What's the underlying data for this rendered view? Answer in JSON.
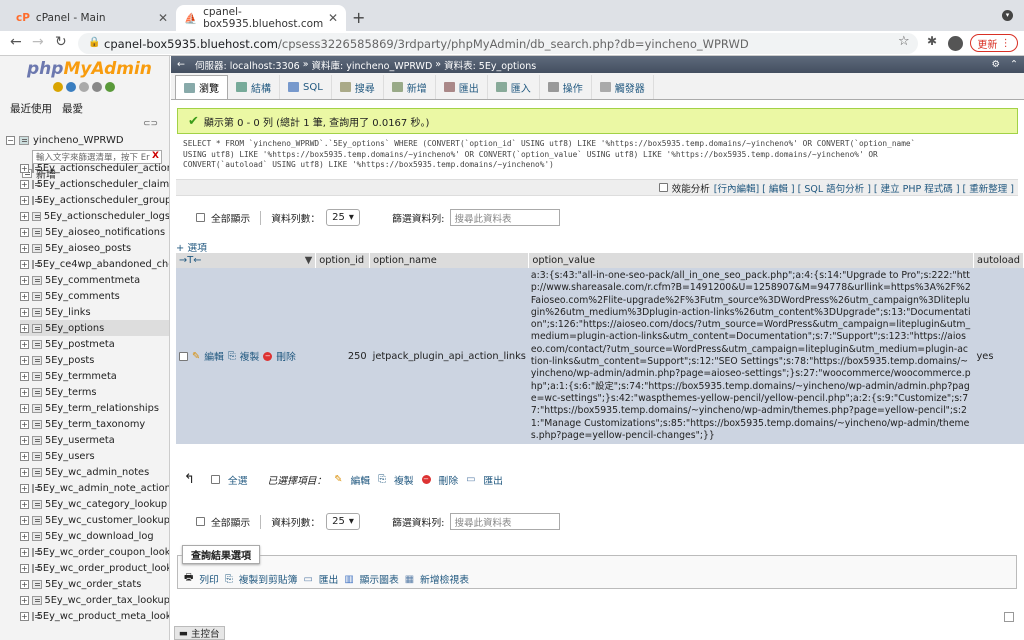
{
  "browser": {
    "tabs": [
      {
        "title": "cPanel - Main"
      },
      {
        "title": "cpanel-box5935.bluehost.com"
      }
    ],
    "url_host": "cpanel-box5935.bluehost.com",
    "url_path": "/cpsess3226585869/3rdparty/phpMyAdmin/db_search.php?db=yincheno_WPRWD",
    "update_label": "更新"
  },
  "sidebar": {
    "logo_php": "php",
    "logo_myadmin": "MyAdmin",
    "recent": "最近使用",
    "favorites": "最愛",
    "database": "yincheno_WPRWD",
    "filter_placeholder": "輸入文字來篩選清單，按下 Er",
    "filter_clear": "X",
    "new_label": "新增",
    "tables": [
      "5Ey_actionscheduler_actions",
      "5Ey_actionscheduler_claims",
      "5Ey_actionscheduler_groups",
      "5Ey_actionscheduler_logs",
      "5Ey_aioseo_notifications",
      "5Ey_aioseo_posts",
      "5Ey_ce4wp_abandoned_che",
      "5Ey_commentmeta",
      "5Ey_comments",
      "5Ey_links",
      "5Ey_options",
      "5Ey_postmeta",
      "5Ey_posts",
      "5Ey_termmeta",
      "5Ey_terms",
      "5Ey_term_relationships",
      "5Ey_term_taxonomy",
      "5Ey_usermeta",
      "5Ey_users",
      "5Ey_wc_admin_notes",
      "5Ey_wc_admin_note_actions",
      "5Ey_wc_category_lookup",
      "5Ey_wc_customer_lookup",
      "5Ey_wc_download_log",
      "5Ey_wc_order_coupon_looku",
      "5Ey_wc_order_product_looku",
      "5Ey_wc_order_stats",
      "5Ey_wc_order_tax_lookup",
      "5Ey_wc_product_meta_looku"
    ],
    "selected_table": "5Ey_options"
  },
  "breadcrumb": {
    "server": "伺服器: localhost:3306",
    "db": "資料庫: yincheno_WPRWD",
    "table": "資料表: 5Ey_options"
  },
  "menu": {
    "items": [
      "瀏覽",
      "結構",
      "SQL",
      "搜尋",
      "新增",
      "匯出",
      "匯入",
      "操作",
      "觸發器"
    ]
  },
  "success_message": "顯示第 0 - 0 列 (總計 1 筆, 查詢用了 0.0167 秒。)",
  "sql": {
    "line1": "SELECT * FROM `yincheno_WPRWD`.`5Ey_options` WHERE (CONVERT(`option_id` USING utf8) LIKE '%https://box5935.temp.domains/~yincheno%' OR CONVERT(`option_name`",
    "line2": "USING utf8) LIKE '%https://box5935.temp.domains/~yincheno%' OR CONVERT(`option_value` USING utf8) LIKE '%https://box5935.temp.domains/~yincheno%' OR",
    "line3": "CONVERT(`autoload` USING utf8) LIKE '%https://box5935.temp.domains/~yincheno%')"
  },
  "profiling": {
    "label": "效能分析",
    "links": "[行內編輯] [ 編輯 ] [ SQL 語句分析 ] [ 建立 PHP 程式碼 ] [ 重新整理 ]"
  },
  "controls": {
    "show_all": "全部顯示",
    "rows_label": "資料列數：",
    "rows_value": "25",
    "filter_label": "篩選資料列:",
    "filter_placeholder": "搜尋此資料表"
  },
  "options_link": "+ 選項",
  "table": {
    "headers": [
      "option_id",
      "option_name",
      "option_value",
      "autoload"
    ],
    "row": {
      "edit": "編輯",
      "copy": "複製",
      "delete": "刪除",
      "option_id": "250",
      "option_name": "jetpack_plugin_api_action_links",
      "option_value": "a:3:{s:43:\"all-in-one-seo-pack/all_in_one_seo_pack.php\";a:4:{s:14:\"Upgrade to Pro\";s:222:\"http://www.shareasale.com/r.cfm?B=1491200&U=1258907&M=94778&urllink=https%3A%2F%2Faioseo.com%2Flite-upgrade%2F%3Futm_source%3DWordPress%26utm_campaign%3Dliteplugin%26utm_medium%3Dplugin-action-links%26utm_content%3DUpgrade\";s:13:\"Documentation\";s:126:\"https://aioseo.com/docs/?utm_source=WordPress&utm_campaign=liteplugin&utm_medium=plugin-action-links&utm_content=Documentation\";s:7:\"Support\";s:123:\"https://aioseo.com/contact/?utm_source=WordPress&utm_campaign=liteplugin&utm_medium=plugin-action-links&utm_content=Support\";s:12:\"SEO Settings\";s:78:\"https://box5935.temp.domains/~yincheno/wp-admin/admin.php?page=aioseo-settings\";}s:27:\"woocommerce/woocommerce.php\";a:1:{s:6:\"設定\";s:74:\"https://box5935.temp.domains/~yincheno/wp-admin/admin.php?page=wc-settings\";}s:42:\"waspthemes-yellow-pencil/yellow-pencil.php\";a:2:{s:9:\"Customize\";s:77:\"https://box5935.temp.domains/~yincheno/wp-admin/themes.php?page=yellow-pencil\";s:21:\"Manage Customizations\";s:85:\"https://box5935.temp.domains/~yincheno/wp-admin/themes.php?page=yellow-pencil-changes\";}}",
      "autoload": "yes"
    }
  },
  "bulk": {
    "check_all": "全選",
    "with_selected": "已選擇項目：",
    "edit": "編輯",
    "copy": "複製",
    "delete": "刪除",
    "export": "匯出"
  },
  "query_ops": {
    "legend": "查詢結果選項",
    "links": [
      "列印",
      "複製到剪貼簿",
      "匯出",
      "顯示圖表",
      "新增檢視表"
    ]
  },
  "console_label": "主控台"
}
